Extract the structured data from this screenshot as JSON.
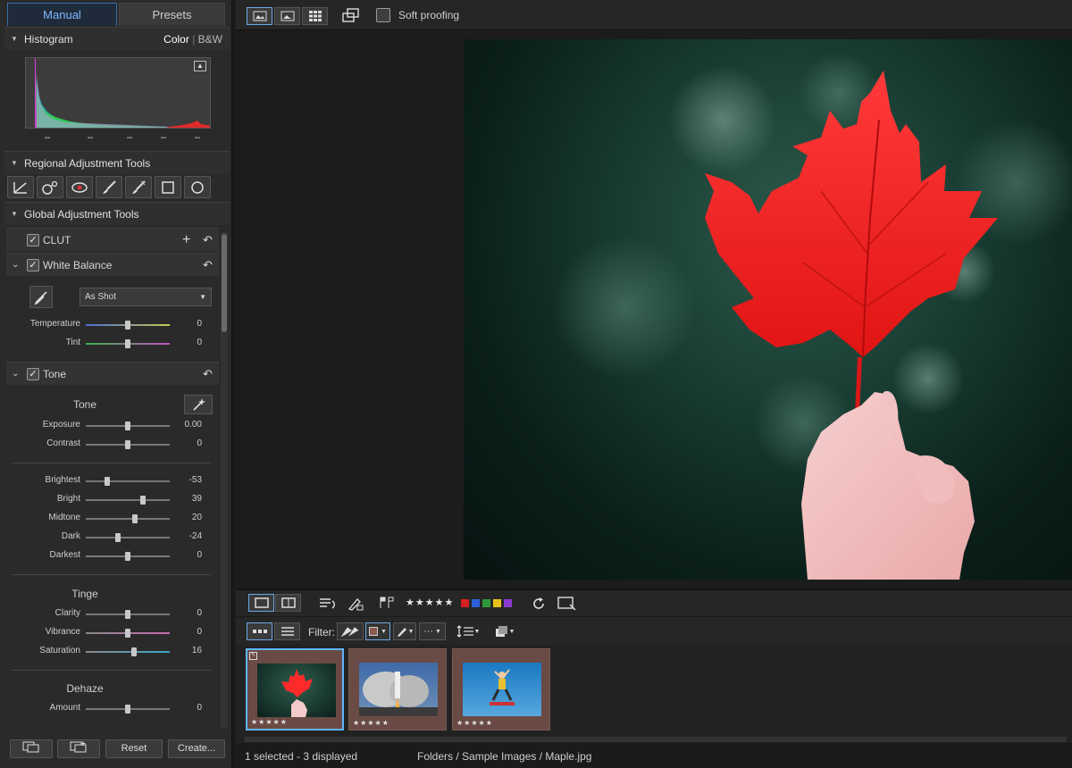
{
  "tabs": {
    "manual": "Manual",
    "presets": "Presets"
  },
  "histogram": {
    "title": "Histogram",
    "mode_color": "Color",
    "mode_bw": "B&W",
    "tick_labels": [
      "–",
      "–",
      "–",
      "–",
      "–"
    ]
  },
  "regional": {
    "title": "Regional Adjustment Tools",
    "tools": [
      "curve-icon",
      "spot-removal-icon",
      "red-eye-icon",
      "brush-icon",
      "eraser-brush-icon",
      "rectangle-icon",
      "circle-icon"
    ]
  },
  "global": {
    "title": "Global Adjustment Tools"
  },
  "clut": {
    "label": "CLUT"
  },
  "white_balance": {
    "label": "White Balance",
    "preset": "As Shot",
    "sliders": [
      {
        "label": "Temperature",
        "value": "0",
        "pos": 0.5
      },
      {
        "label": "Tint",
        "value": "0",
        "pos": 0.5
      }
    ]
  },
  "tone": {
    "label": "Tone",
    "section_tone": "Tone",
    "sliders_main": [
      {
        "label": "Exposure",
        "value": "0.00",
        "pos": 0.5
      },
      {
        "label": "Contrast",
        "value": "0",
        "pos": 0.5
      }
    ],
    "sliders_range": [
      {
        "label": "Brightest",
        "value": "-53",
        "pos": 0.25
      },
      {
        "label": "Bright",
        "value": "39",
        "pos": 0.68
      },
      {
        "label": "Midtone",
        "value": "20",
        "pos": 0.58
      },
      {
        "label": "Dark",
        "value": "-24",
        "pos": 0.38
      },
      {
        "label": "Darkest",
        "value": "0",
        "pos": 0.5
      }
    ],
    "section_tinge": "Tinge",
    "sliders_tinge": [
      {
        "label": "Clarity",
        "value": "0",
        "pos": 0.5
      },
      {
        "label": "Vibrance",
        "value": "0",
        "pos": 0.5
      },
      {
        "label": "Saturation",
        "value": "16",
        "pos": 0.57
      }
    ],
    "section_dehaze": "Dehaze",
    "sliders_dehaze": [
      {
        "label": "Amount",
        "value": "0",
        "pos": 0.5
      }
    ]
  },
  "bottom_buttons": {
    "reset": "Reset",
    "create": "Create..."
  },
  "topbar": {
    "soft_proofing": "Soft proofing"
  },
  "filter": {
    "label": "Filter:"
  },
  "rating_stars": "★★★★★",
  "color_labels": [
    "#d62020",
    "#2c5fd6",
    "#2f9a3a",
    "#e8c21a",
    "#8b3bd1"
  ],
  "thumbnails": [
    {
      "name": "Maple",
      "stars": "★★★★★",
      "selected": true
    },
    {
      "name": "Rocket",
      "stars": "★★★★★",
      "selected": false
    },
    {
      "name": "Skateboarder",
      "stars": "★★★★★",
      "selected": false
    }
  ],
  "status": {
    "selection": "1 selected - 3 displayed",
    "path": "Folders / Sample Images / Maple.jpg"
  }
}
